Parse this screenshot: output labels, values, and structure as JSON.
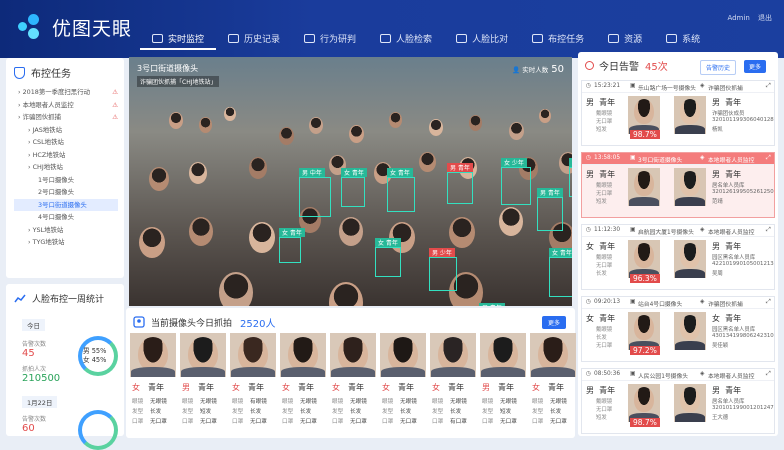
{
  "app": {
    "name": "优图天眼",
    "user": "Admin",
    "logout": "退出"
  },
  "nav": [
    {
      "label": "实时监控",
      "active": true,
      "icon": "monitor-icon"
    },
    {
      "label": "历史记录",
      "active": false,
      "icon": "history-icon"
    },
    {
      "label": "行为研判",
      "active": false,
      "icon": "trend-icon"
    },
    {
      "label": "人脸检索",
      "active": false,
      "icon": "face-search-icon"
    },
    {
      "label": "人脸比对",
      "active": false,
      "icon": "compare-icon"
    },
    {
      "label": "布控任务",
      "active": false,
      "icon": "shield-icon"
    },
    {
      "label": "资源",
      "active": false,
      "icon": "folder-icon"
    },
    {
      "label": "系统",
      "active": false,
      "icon": "gear-icon"
    }
  ],
  "tasks": {
    "title": "布控任务",
    "tree": [
      {
        "label": "2018第一季度扫黑行动",
        "level": 0,
        "alert": "⚠"
      },
      {
        "label": "本地眼者人员监控",
        "level": 0,
        "alert": "⚠"
      },
      {
        "label": "诈骗团伙抓捕",
        "level": 0,
        "alert": "⚠"
      },
      {
        "label": "JAS地铁站",
        "level": 1,
        "alert": ""
      },
      {
        "label": "CSL地铁站",
        "level": 1,
        "alert": ""
      },
      {
        "label": "HCZ地铁站",
        "level": 1,
        "alert": ""
      },
      {
        "label": "CHJ地铁站",
        "level": 1,
        "alert": ""
      },
      {
        "label": "1号口摄像头",
        "level": 2,
        "alert": ""
      },
      {
        "label": "2号口摄像头",
        "level": 2,
        "alert": ""
      },
      {
        "label": "3号口街道摄像头",
        "level": 2,
        "alert": "",
        "selected": true
      },
      {
        "label": "4号口摄像头",
        "level": 2,
        "alert": ""
      },
      {
        "label": "YSL地铁站",
        "level": 1,
        "alert": ""
      },
      {
        "label": "TYG地铁站",
        "level": 1,
        "alert": ""
      }
    ]
  },
  "weekly": {
    "title": "人脸布控一周统计",
    "days": [
      {
        "date": "今日",
        "alert_label": "告警次数",
        "alert_value": "45",
        "capture_label": "抓拍人次",
        "capture_value": "210500",
        "male": "男 55%",
        "female": "女 45%"
      },
      {
        "date": "1月22日",
        "alert_label": "告警次数",
        "alert_value": "60"
      }
    ]
  },
  "video": {
    "title": "3号口街道摄像头",
    "subtitle": "诈骗团伙抓捕「CHJ地铁站」",
    "count_label": "实时人数",
    "count": "50",
    "labels": [
      "男 中年",
      "女 青年",
      "女 青年",
      "男 青年",
      "女 少年",
      "男 青年",
      "女 青年",
      "男 少年",
      "女 青年",
      "男 青年",
      "女 青年",
      "女 青年"
    ]
  },
  "captures": {
    "title": "当前摄像头今日抓拍",
    "count": "2520人",
    "more": "更多",
    "field_labels": [
      "眼镜",
      "发型",
      "口罩"
    ],
    "items": [
      {
        "gender": "女",
        "age": "青年",
        "glasses": "无眼镜",
        "hair": "长发",
        "mask": "无口罩"
      },
      {
        "gender": "男",
        "age": "青年",
        "glasses": "无眼镜",
        "hair": "短发",
        "mask": "无口罩"
      },
      {
        "gender": "女",
        "age": "青年",
        "glasses": "有眼镜",
        "hair": "长发",
        "mask": "无口罩"
      },
      {
        "gender": "女",
        "age": "青年",
        "glasses": "无眼镜",
        "hair": "长发",
        "mask": "无口罩"
      },
      {
        "gender": "女",
        "age": "青年",
        "glasses": "无眼镜",
        "hair": "长发",
        "mask": "无口罩"
      },
      {
        "gender": "女",
        "age": "青年",
        "glasses": "无眼镜",
        "hair": "长发",
        "mask": "无口罩"
      },
      {
        "gender": "女",
        "age": "青年",
        "glasses": "无眼镜",
        "hair": "长发",
        "mask": "有口罩"
      },
      {
        "gender": "男",
        "age": "青年",
        "glasses": "无眼镜",
        "hair": "短发",
        "mask": "无口罩"
      },
      {
        "gender": "女",
        "age": "青年",
        "glasses": "无眼镜",
        "hair": "长发",
        "mask": "无口罩"
      }
    ]
  },
  "alerts": {
    "title": "今日告警",
    "count": "45次",
    "btn_history": "告警历史",
    "btn_more": "更多",
    "cards": [
      {
        "time": "15:23:21",
        "camera": "乐山路广场一号摄像头",
        "task": "诈骗团伙抓捕",
        "left_gender": "男",
        "left_age": "青年",
        "left_attrs": [
          "戴眼镜",
          "无口罩",
          "短发"
        ],
        "score": "98.7%",
        "right_gender": "男",
        "right_age": "青年",
        "right_info": [
          "诈骗团伙成员",
          "320101199306040128",
          "杨凯"
        ],
        "highlight": false
      },
      {
        "time": "13:58:05",
        "camera": "3号口街道摄像头",
        "task": "本地眼者人员监控",
        "left_gender": "男",
        "left_age": "青年",
        "left_attrs": [
          "戴眼镜",
          "无口罩",
          "短发"
        ],
        "score": "",
        "right_gender": "男",
        "right_age": "青年",
        "right_info": [
          "居名单人员库",
          "320126199505261250",
          "范靖"
        ],
        "highlight": true
      },
      {
        "time": "11:12:30",
        "camera": "启航园大厦1号摄像头",
        "task": "本地眼者人员监控",
        "left_gender": "女",
        "left_age": "青年",
        "left_attrs": [
          "戴眼镜",
          "无口罩",
          "长发"
        ],
        "score": "96.3%",
        "right_gender": "男",
        "right_age": "青年",
        "right_info": [
          "园区黑名单人员库",
          "422101990105001213",
          "吴周"
        ],
        "highlight": false
      },
      {
        "time": "09:20:13",
        "camera": "站台4号口摄像头",
        "task": "诈骗团伙抓捕",
        "left_gender": "女",
        "left_age": "青年",
        "left_attrs": [
          "戴眼镜",
          "长发",
          "无口罩"
        ],
        "score": "97.2%",
        "right_gender": "女",
        "right_age": "青年",
        "right_info": [
          "园区黑名单人员库",
          "430134199806242310",
          "吴佳颖"
        ],
        "highlight": false
      },
      {
        "time": "08:50:36",
        "camera": "人民公园1号摄像头",
        "task": "本地眼者人员监控",
        "left_gender": "男",
        "left_age": "青年",
        "left_attrs": [
          "戴眼镜",
          "无口罩",
          "短发"
        ],
        "score": "98.7%",
        "right_gender": "男",
        "right_age": "青年",
        "right_info": [
          "居名单人员库",
          "320101199001201247",
          "王大德"
        ],
        "highlight": false
      }
    ]
  },
  "colors": {
    "brand": "#1a3c9c",
    "accent": "#2a6df0",
    "alert": "#e24b4b",
    "box": "#33e0c0"
  }
}
